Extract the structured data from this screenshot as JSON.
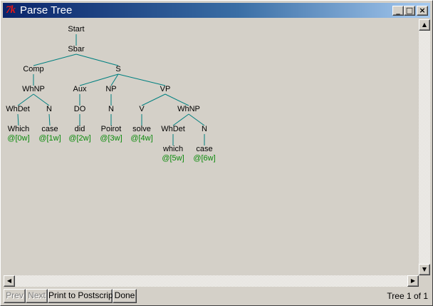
{
  "window": {
    "title": "Parse Tree",
    "icon_glyph": "7k",
    "controls": {
      "minimize": "_",
      "maximize": "□",
      "close": "×"
    }
  },
  "tree": {
    "edge_color": "#008080",
    "leaf_color": "#0a8a0a",
    "nodes": [
      {
        "id": "start",
        "label": "Start",
        "kind": "category"
      },
      {
        "id": "sbar",
        "label": "Sbar",
        "kind": "category"
      },
      {
        "id": "comp",
        "label": "Comp",
        "kind": "category"
      },
      {
        "id": "s",
        "label": "S",
        "kind": "category"
      },
      {
        "id": "whnp1",
        "label": "WhNP",
        "kind": "category"
      },
      {
        "id": "aux",
        "label": "Aux",
        "kind": "category"
      },
      {
        "id": "np",
        "label": "NP",
        "kind": "category"
      },
      {
        "id": "vp",
        "label": "VP",
        "kind": "category"
      },
      {
        "id": "whdet1",
        "label": "WhDet",
        "kind": "category"
      },
      {
        "id": "n1",
        "label": "N",
        "kind": "category"
      },
      {
        "id": "do",
        "label": "DO",
        "kind": "category"
      },
      {
        "id": "n2",
        "label": "N",
        "kind": "category"
      },
      {
        "id": "v",
        "label": "V",
        "kind": "category"
      },
      {
        "id": "whnp2",
        "label": "WhNP",
        "kind": "category"
      },
      {
        "id": "which1",
        "label": "Which",
        "kind": "word"
      },
      {
        "id": "case1",
        "label": "case",
        "kind": "word"
      },
      {
        "id": "did",
        "label": "did",
        "kind": "word"
      },
      {
        "id": "poirot",
        "label": "Poirot",
        "kind": "word"
      },
      {
        "id": "solve",
        "label": "solve",
        "kind": "word"
      },
      {
        "id": "whdet2",
        "label": "WhDet",
        "kind": "category"
      },
      {
        "id": "n3",
        "label": "N",
        "kind": "category"
      },
      {
        "id": "which2",
        "label": "which",
        "kind": "word"
      },
      {
        "id": "case2",
        "label": "case",
        "kind": "word"
      },
      {
        "id": "p0",
        "label": "@[0w]",
        "kind": "position"
      },
      {
        "id": "p1",
        "label": "@[1w]",
        "kind": "position"
      },
      {
        "id": "p2",
        "label": "@[2w]",
        "kind": "position"
      },
      {
        "id": "p3",
        "label": "@[3w]",
        "kind": "position"
      },
      {
        "id": "p4",
        "label": "@[4w]",
        "kind": "position"
      },
      {
        "id": "p5",
        "label": "@[5w]",
        "kind": "position"
      },
      {
        "id": "p6",
        "label": "@[6w]",
        "kind": "position"
      }
    ],
    "edges": [
      [
        "start",
        "sbar"
      ],
      [
        "sbar",
        "comp"
      ],
      [
        "sbar",
        "s"
      ],
      [
        "comp",
        "whnp1"
      ],
      [
        "s",
        "aux"
      ],
      [
        "s",
        "np"
      ],
      [
        "s",
        "vp"
      ],
      [
        "whnp1",
        "whdet1"
      ],
      [
        "whnp1",
        "n1"
      ],
      [
        "aux",
        "do"
      ],
      [
        "np",
        "n2"
      ],
      [
        "vp",
        "v"
      ],
      [
        "vp",
        "whnp2"
      ],
      [
        "whdet1",
        "which1"
      ],
      [
        "n1",
        "case1"
      ],
      [
        "do",
        "did"
      ],
      [
        "n2",
        "poirot"
      ],
      [
        "v",
        "solve"
      ],
      [
        "whnp2",
        "whdet2"
      ],
      [
        "whnp2",
        "n3"
      ],
      [
        "whdet2",
        "which2"
      ],
      [
        "n3",
        "case2"
      ]
    ]
  },
  "scrollbars": {
    "up": "▲",
    "down": "▼",
    "left": "◀",
    "right": "▶"
  },
  "buttons": {
    "prev": "Prev",
    "next": "Next",
    "print": "Print to Postscript",
    "done": "Done"
  },
  "status": "Tree 1 of 1"
}
